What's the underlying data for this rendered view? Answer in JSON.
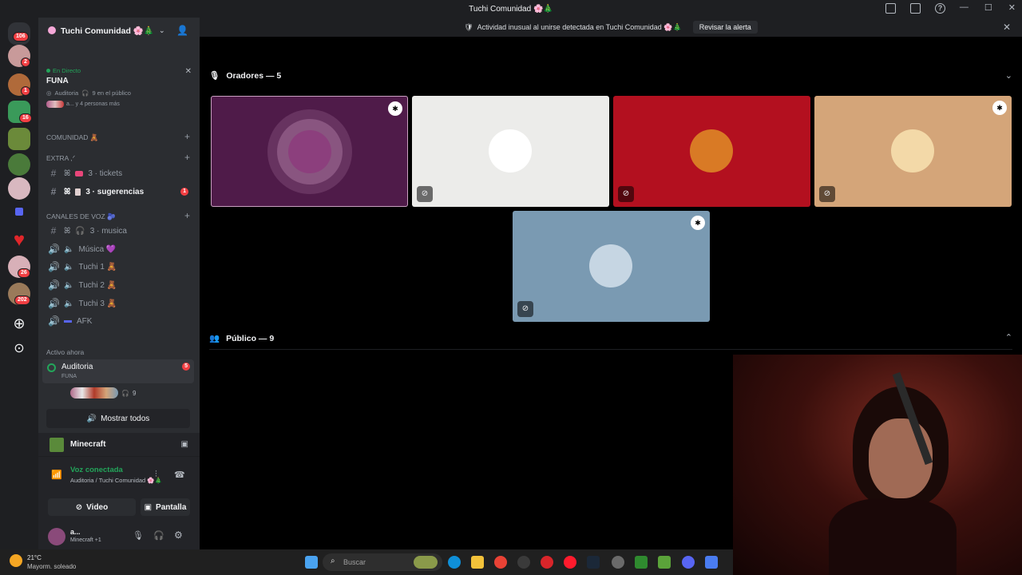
{
  "window": {
    "title": "Tuchi Comunidad 🌸🎄"
  },
  "alert": {
    "text": "Actividad inusual al unirse detectada en Tuchi Comunidad 🌸🎄",
    "button": "Revisar la alerta"
  },
  "servers": {
    "badges": [
      "106",
      "2",
      "1",
      "16",
      "26",
      "202"
    ]
  },
  "guild": {
    "name": "Tuchi Comunidad 🌸🎄"
  },
  "stage": {
    "live_label": "En Directo",
    "name": "FUNA",
    "channel": "Auditoria",
    "audience": "9 en el público",
    "participants": "a... y 4 personas más"
  },
  "categories": {
    "comunidad": "COMUNIDAD 🧸",
    "extra": "EXTRA ,ᐟ",
    "voz": "CANALES DE VOZ 🫐"
  },
  "channels": [
    {
      "prefix": "ꕤ",
      "name": "3 · tickets"
    },
    {
      "prefix": "ꕤ",
      "name": "3 · sugerencias",
      "badge": "1"
    },
    {
      "prefix": "ꕤ",
      "name": "3 · musica"
    }
  ],
  "voice_channels": [
    {
      "name": "Música 💜"
    },
    {
      "name": "Tuchi 1 🧸"
    },
    {
      "name": "Tuchi 2 🧸"
    },
    {
      "name": "Tuchi 3 🧸"
    },
    {
      "name": "AFK"
    }
  ],
  "active_now": {
    "heading": "Activo ahora",
    "channel": "Auditoria",
    "sub": "FUNA",
    "count": "5",
    "listeners": "9",
    "show_all": "Mostrar todos"
  },
  "activity": {
    "game": "Minecraft"
  },
  "voice_status": {
    "label": "Voz conectada",
    "location": "Auditoria / Tuchi Comunidad 🌸🎄",
    "video": "Video",
    "screen": "Pantalla"
  },
  "user": {
    "name": "a...",
    "status": "Minecraft +1"
  },
  "speakers": {
    "title": "Oradores — 5"
  },
  "audience": {
    "title": "Público — 9"
  },
  "tiles": [
    {
      "bg": "#4f1b49",
      "pinned": true,
      "muted": false,
      "avatar": "#8c3f7d"
    },
    {
      "bg": "#ececea",
      "pinned": false,
      "muted": true,
      "avatar": "#ffffff"
    },
    {
      "bg": "#b3101f",
      "pinned": false,
      "muted": true,
      "avatar": "#d97a25"
    },
    {
      "bg": "#d4a579",
      "pinned": true,
      "muted": true,
      "avatar": "#f3d9a8"
    },
    {
      "bg": "#7a9ab2",
      "pinned": true,
      "muted": true,
      "avatar": "#c6d6e3"
    }
  ],
  "weather": {
    "temp": "21°C",
    "desc": "Mayorm. soleado"
  },
  "taskbar": {
    "search_placeholder": "Buscar"
  },
  "colors": {
    "accent": "#5865f2",
    "green": "#23a55a",
    "red": "#f23f43"
  }
}
